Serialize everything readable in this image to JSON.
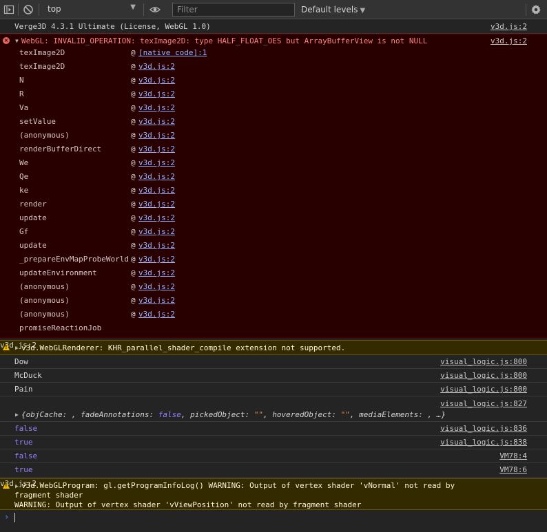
{
  "toolbar": {
    "context": "top",
    "filter_placeholder": "Filter",
    "levels_label": "Default levels",
    "icons": [
      "sidebar-toggle-icon",
      "clear-console-icon",
      "eye-icon",
      "gear-icon"
    ]
  },
  "messages": {
    "m0": {
      "text": "Verge3D 4.3.1 Ultimate (License, WebGL 1.0)",
      "source": "v3d.js:2"
    },
    "error": {
      "text": "WebGL: INVALID_OPERATION: texImage2D: type HALF_FLOAT_OES but ArrayBufferView is not NULL",
      "source": "v3d.js:2",
      "frames": [
        {
          "fn": "texImage2D",
          "at": "@",
          "loc": "[native code]:1"
        },
        {
          "fn": "texImage2D",
          "at": "@",
          "loc": "v3d.js:2"
        },
        {
          "fn": "N",
          "at": "@",
          "loc": "v3d.js:2"
        },
        {
          "fn": "R",
          "at": "@",
          "loc": "v3d.js:2"
        },
        {
          "fn": "Va",
          "at": "@",
          "loc": "v3d.js:2"
        },
        {
          "fn": "setValue",
          "at": "@",
          "loc": "v3d.js:2"
        },
        {
          "fn": "(anonymous)",
          "at": "@",
          "loc": "v3d.js:2"
        },
        {
          "fn": "renderBufferDirect",
          "at": "@",
          "loc": "v3d.js:2"
        },
        {
          "fn": "We",
          "at": "@",
          "loc": "v3d.js:2"
        },
        {
          "fn": "Qe",
          "at": "@",
          "loc": "v3d.js:2"
        },
        {
          "fn": "ke",
          "at": "@",
          "loc": "v3d.js:2"
        },
        {
          "fn": "render",
          "at": "@",
          "loc": "v3d.js:2"
        },
        {
          "fn": "update",
          "at": "@",
          "loc": "v3d.js:2"
        },
        {
          "fn": "Gf",
          "at": "@",
          "loc": "v3d.js:2"
        },
        {
          "fn": "update",
          "at": "@",
          "loc": "v3d.js:2"
        },
        {
          "fn": "_prepareEnvMapProbeWorld",
          "at": "@",
          "loc": "v3d.js:2"
        },
        {
          "fn": "updateEnvironment",
          "at": "@",
          "loc": "v3d.js:2"
        },
        {
          "fn": "(anonymous)",
          "at": "@",
          "loc": "v3d.js:2"
        },
        {
          "fn": "(anonymous)",
          "at": "@",
          "loc": "v3d.js:2"
        },
        {
          "fn": "(anonymous)",
          "at": "@",
          "loc": "v3d.js:2"
        },
        {
          "fn": "promiseReactionJob",
          "at": "",
          "loc": ""
        }
      ]
    },
    "warn1": {
      "text": "v3d.WebGLRenderer: KHR_parallel_shader_compile extension not supported.",
      "source": "v3d.js:2"
    },
    "m1": {
      "text": "Dow",
      "source": "visual_logic.js:800"
    },
    "m2": {
      "text": "McDuck",
      "source": "visual_logic.js:800"
    },
    "m3": {
      "text": "Pain",
      "source": "visual_logic.js:800"
    },
    "obj": {
      "source": "visual_logic.js:827",
      "open": "{",
      "k1": "objCache",
      "v1": " ",
      "k2": "fadeAnnotations",
      "v2": "false",
      "k3": "pickedObject",
      "v3": "\"\"",
      "k4": "hoveredObject",
      "v4": "\"\"",
      "k5": "mediaElements",
      "v5": " ",
      "close": "…}"
    },
    "m4": {
      "text": "false",
      "source": "visual_logic.js:836"
    },
    "m5": {
      "text": "true",
      "source": "visual_logic.js:838"
    },
    "m6": {
      "text": "false",
      "source": "VM78:4"
    },
    "m7": {
      "text": "true",
      "source": "VM78:6"
    },
    "warn2": {
      "line1": "v3d.WebGLProgram: gl.getProgramInfoLog() WARNING: Output of vertex shader 'vNormal' not read by",
      "line2": "fragment shader",
      "line3": "WARNING: Output of vertex shader 'vViewPosition' not read by fragment shader",
      "source": "v3d.js:2"
    }
  }
}
